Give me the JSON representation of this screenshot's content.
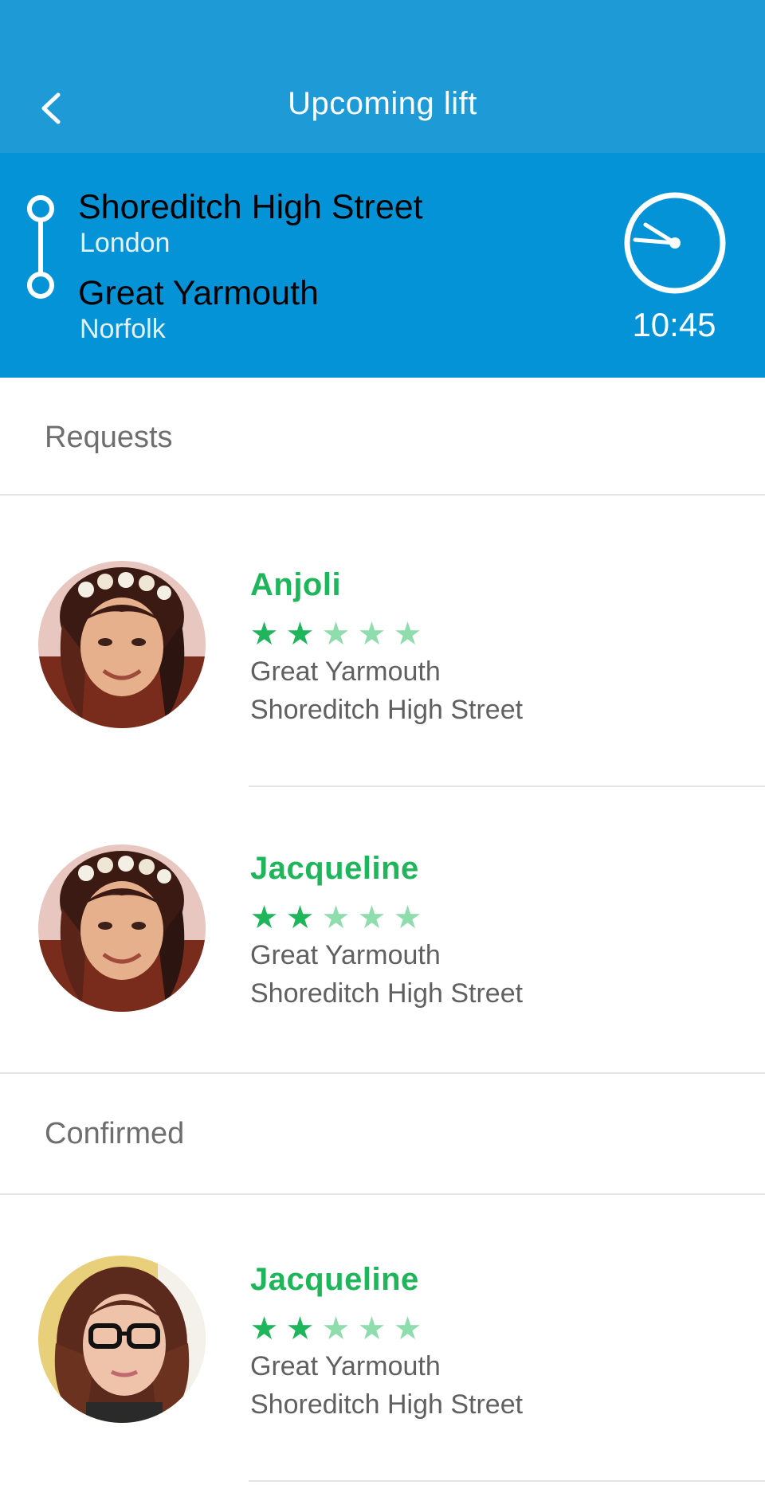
{
  "header": {
    "title": "Upcoming lift",
    "back_icon": "chevron-left-icon"
  },
  "route": {
    "from": {
      "name": "Shoreditch High Street",
      "area": "London"
    },
    "to": {
      "name": "Great Yarmouth",
      "area": "Norfolk"
    },
    "time": "10:45",
    "clock_icon": "clock-icon"
  },
  "colors": {
    "appbar": "#1e9bd7",
    "route_bar": "#0493d6",
    "accent_green": "#1fb55a",
    "star_inactive": "#8fdcac"
  },
  "sections": {
    "requests_label": "Requests",
    "confirmed_label": "Confirmed"
  },
  "requests": [
    {
      "name": "Anjoli",
      "rating": 2,
      "rating_max": 5,
      "line1": "Great Yarmouth",
      "line2": "Shoreditch High Street"
    },
    {
      "name": "Jacqueline",
      "rating": 2,
      "rating_max": 5,
      "line1": "Great Yarmouth",
      "line2": "Shoreditch High Street"
    }
  ],
  "confirmed": [
    {
      "name": "Jacqueline",
      "rating": 2,
      "rating_max": 5,
      "line1": "Great Yarmouth",
      "line2": "Shoreditch High Street"
    }
  ]
}
